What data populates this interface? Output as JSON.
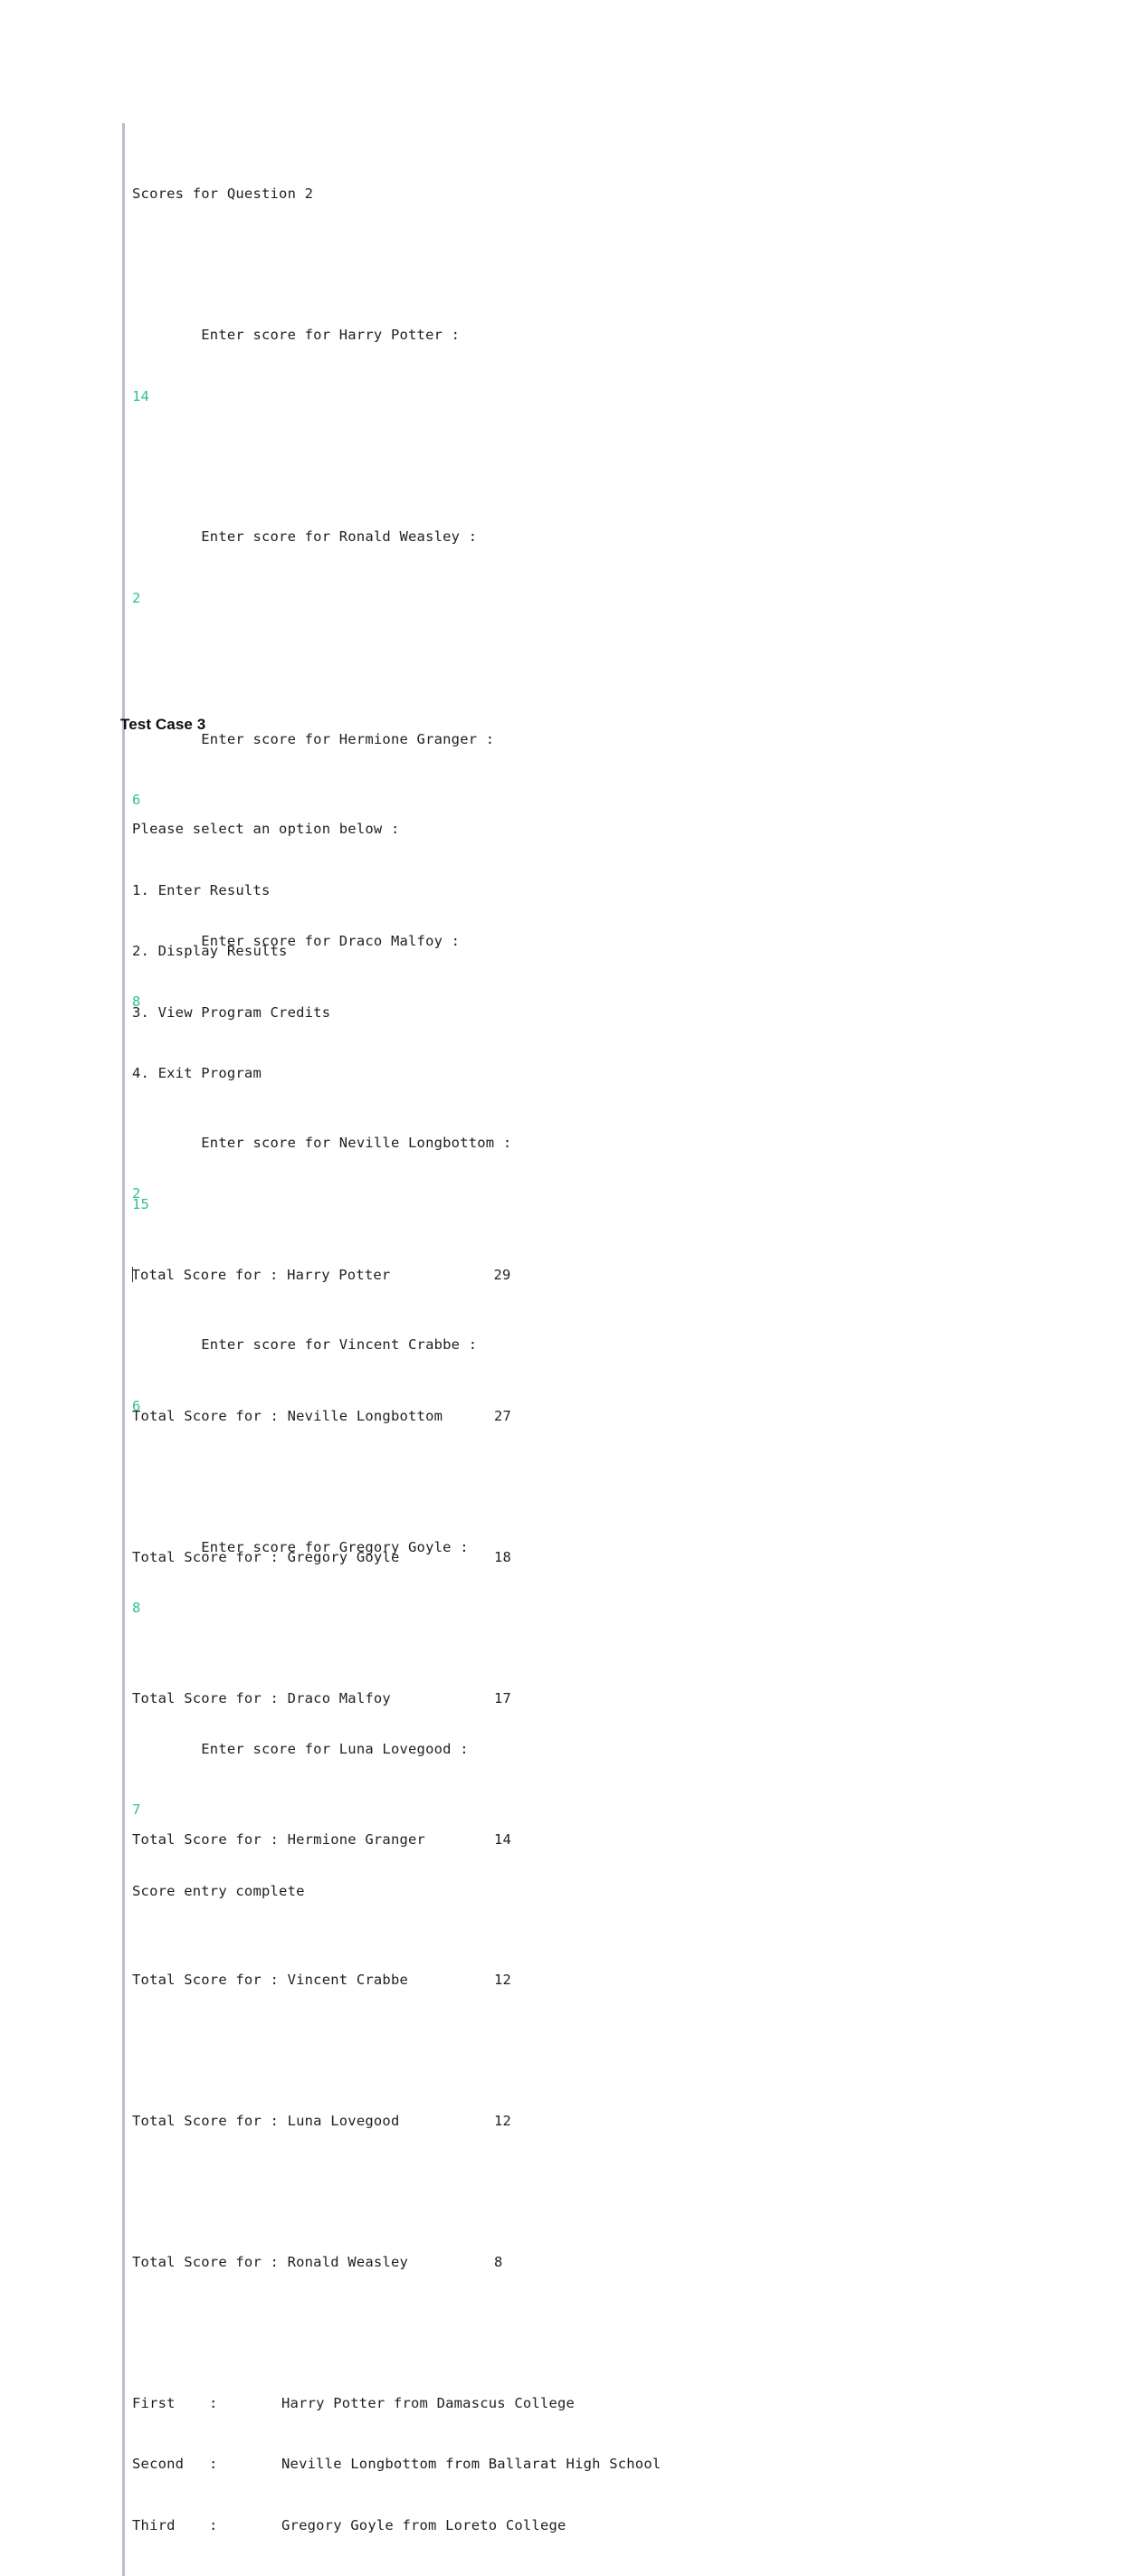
{
  "document": {
    "background": "#ffffff",
    "accent_input_color": "#2fc28a",
    "console_border_color": "#b9bdd4"
  },
  "test_case_2_console": {
    "title_line": "Scores for Question 2",
    "prompts": [
      {
        "prompt": "        Enter score for Harry Potter :",
        "input": "14"
      },
      {
        "prompt": "        Enter score for Ronald Weasley :",
        "input": "2"
      },
      {
        "prompt": "        Enter score for Hermione Granger :",
        "input": "6"
      },
      {
        "prompt": "        Enter score for Draco Malfoy :",
        "input": "8"
      },
      {
        "prompt": "        Enter score for Neville Longbottom :",
        "input": "15"
      },
      {
        "prompt": "        Enter score for Vincent Crabbe :",
        "input": "6"
      },
      {
        "prompt": "        Enter score for Gregory Goyle :",
        "input": "8"
      },
      {
        "prompt": "        Enter score for Luna Lovegood :",
        "input": "7"
      }
    ],
    "completion_line": "Score entry complete"
  },
  "test_case_3_heading": "Test Case 3",
  "test_case_3_console": {
    "menu_prompt": "Please select an option below :",
    "menu_options": [
      "1. Enter Results",
      "2. Display Results",
      "3. View Program Credits",
      "4. Exit Program"
    ],
    "menu_input": "2",
    "totals_label_prefix": "Total Score for : ",
    "totals": [
      {
        "name": "Harry Potter",
        "score": "29"
      },
      {
        "name": "Neville Longbottom",
        "score": "27"
      },
      {
        "name": "Gregory Goyle",
        "score": "18"
      },
      {
        "name": "Draco Malfoy",
        "score": "17"
      },
      {
        "name": "Hermione Granger",
        "score": "14"
      },
      {
        "name": "Vincent Crabbe",
        "score": "12"
      },
      {
        "name": "Luna Lovegood",
        "score": "12"
      },
      {
        "name": "Ronald Weasley",
        "score": "8"
      }
    ],
    "rankings": [
      {
        "position": "First",
        "colon": ":",
        "detail": "Harry Potter from Damascus College"
      },
      {
        "position": "Second",
        "colon": ":",
        "detail": "Neville Longbottom from Ballarat High School"
      },
      {
        "position": "Third",
        "colon": ":",
        "detail": "Gregory Goyle from Loreto College"
      }
    ]
  }
}
